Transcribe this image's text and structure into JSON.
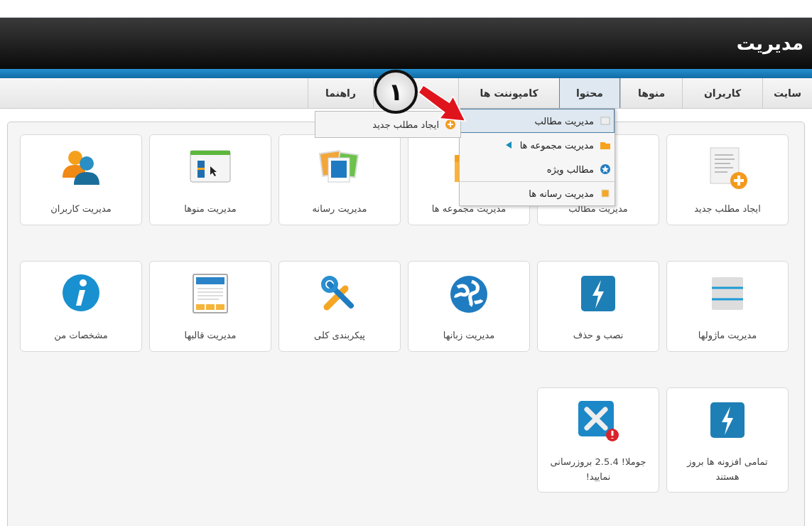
{
  "header": {
    "title": "مدیریت"
  },
  "menu": [
    {
      "label": "سایت",
      "selected": false
    },
    {
      "label": "کاربران",
      "selected": false
    },
    {
      "label": "منوها",
      "selected": false
    },
    {
      "label": "محتوا",
      "selected": true
    },
    {
      "label": "کامپوننت ها",
      "selected": false
    },
    {
      "label": "راهنما",
      "selected": false
    }
  ],
  "dropdown": {
    "items": [
      {
        "label": "مدیریت مطالب",
        "selected": true,
        "has_submenu": false,
        "divider_before": false
      },
      {
        "label": "مدیریت مجموعه ها",
        "selected": false,
        "has_submenu": true,
        "divider_before": false
      },
      {
        "label": "مطالب ویژه",
        "selected": false,
        "has_submenu": false,
        "divider_before": false
      },
      {
        "label": "مدیریت رسانه ها",
        "selected": false,
        "has_submenu": false,
        "divider_before": true
      }
    ],
    "submenu": [
      {
        "label": "ایجاد مطلب جدید"
      }
    ]
  },
  "annotation": {
    "number": "۱"
  },
  "cards": [
    {
      "label": "ایجاد مطلب جدید"
    },
    {
      "label": "مدیریت مطالب"
    },
    {
      "label": "مدیریت مجموعه ها"
    },
    {
      "label": "مدیریت رسانه"
    },
    {
      "label": "مدیریت منوها"
    },
    {
      "label": "مدیریت کاربران"
    },
    {
      "label": "مدیریت ماژولها"
    },
    {
      "label": "نصب و حذف"
    },
    {
      "label": "مدیریت زبانها"
    },
    {
      "label": "پیکربندی کلی"
    },
    {
      "label": "مدیریت قالبها"
    },
    {
      "label": "مشخصات من"
    },
    {
      "label": "تمامی افزونه ها بروز هستند"
    },
    {
      "label": "جوملا! 2.5.4 بروزرسانی نمایید!"
    }
  ]
}
